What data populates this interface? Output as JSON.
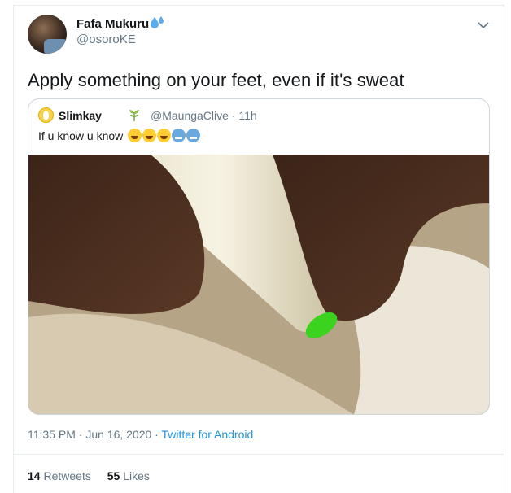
{
  "tweet": {
    "author": {
      "name": "Fafa Mukuru",
      "handle": "@osoroKE",
      "name_icon": "sweat-droplets-icon"
    },
    "text": "Apply something on your feet, even if it's sweat",
    "quoted": {
      "name": "Slimkay",
      "name_icon": "herb-icon",
      "handle_time": "@MaungaClive · 11h",
      "text": "If u know u know",
      "emojis": [
        "laughing-tears-icon",
        "laughing-tears-icon",
        "rolling-laughing-icon",
        "cold-face-icon",
        "cold-face-icon"
      ],
      "image": "photo of bare feet with a plastic water bottle"
    },
    "timestamp": "11:35 PM · Jun 16, 2020 · ",
    "source": "Twitter for Android",
    "stats": {
      "retweets_count": "14",
      "retweets_label": "Retweets",
      "likes_count": "55",
      "likes_label": "Likes"
    }
  },
  "colors": {
    "accent": "#1b95e0",
    "secondary_text": "#657786",
    "border": "#ccd6dd"
  }
}
